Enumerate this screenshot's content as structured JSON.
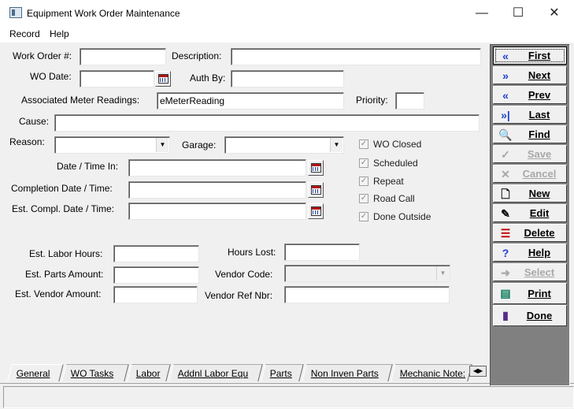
{
  "window": {
    "title": "Equipment Work Order Maintenance",
    "minimize": "—",
    "maximize": "☐",
    "close": "✕"
  },
  "menu": [
    "Record",
    "Help"
  ],
  "form": {
    "work_order_label": "Work Order #:",
    "work_order_value": "",
    "description_label": "Description:",
    "description_value": "",
    "wo_date_label": "WO Date:",
    "wo_date_value": "",
    "auth_by_label": "Auth By:",
    "auth_by_value": "",
    "meter_label": "Associated Meter Readings:",
    "meter_value": "eMeterReading",
    "priority_label": "Priority:",
    "priority_value": "",
    "cause_label": "Cause:",
    "cause_value": "",
    "reason_label": "Reason:",
    "reason_value": "",
    "garage_label": "Garage:",
    "garage_value": "",
    "date_time_in_label": "Date / Time In:",
    "completion_label": "Completion Date / Time:",
    "est_compl_label": "Est. Compl. Date / Time:",
    "labor_hours_label": "Est. Labor Hours:",
    "parts_amount_label": "Est. Parts Amount:",
    "vendor_amount_label": "Est. Vendor Amount:",
    "hours_lost_label": "Hours Lost:",
    "vendor_code_label": "Vendor Code:",
    "vendor_ref_label": "Vendor Ref Nbr:"
  },
  "checkboxes": [
    {
      "label": "WO Closed",
      "checked": true
    },
    {
      "label": "Scheduled",
      "checked": true
    },
    {
      "label": "Repeat",
      "checked": true
    },
    {
      "label": "Road Call",
      "checked": true
    },
    {
      "label": "Done Outside",
      "checked": true
    }
  ],
  "tabs": [
    "General",
    "WO Tasks",
    "Labor",
    "Addnl Labor Equ",
    "Parts",
    "Non Inven Parts",
    "Mechanic Note:"
  ],
  "buttons": [
    {
      "label": "First",
      "icon": "double-left-arrow-icon",
      "enabled": true
    },
    {
      "label": "Next",
      "icon": "double-right-arrow-icon",
      "enabled": true
    },
    {
      "label": "Prev",
      "icon": "left-arrow-icon",
      "enabled": true
    },
    {
      "label": "Last",
      "icon": "last-arrow-icon",
      "enabled": true
    },
    {
      "label": "Find",
      "icon": "magnifier-icon",
      "enabled": true
    },
    {
      "label": "Save",
      "icon": "checkmark-icon",
      "enabled": false
    },
    {
      "label": "Cancel",
      "icon": "x-icon",
      "enabled": false
    },
    {
      "label": "New",
      "icon": "new-document-icon",
      "enabled": true
    },
    {
      "label": "Edit",
      "icon": "edit-document-icon",
      "enabled": true
    },
    {
      "label": "Delete",
      "icon": "delete-list-icon",
      "enabled": true
    },
    {
      "label": "Help",
      "icon": "question-mark-icon",
      "enabled": true
    },
    {
      "label": "Select",
      "icon": "select-arrow-icon",
      "enabled": false
    },
    {
      "label": "Print",
      "icon": "printer-icon",
      "enabled": true
    },
    {
      "label": "Done",
      "icon": "door-exit-icon",
      "enabled": true
    }
  ],
  "colors": {
    "accent_blue": "#1f3fd0",
    "disabled": "#a8a8a8",
    "panel": "#808080"
  }
}
